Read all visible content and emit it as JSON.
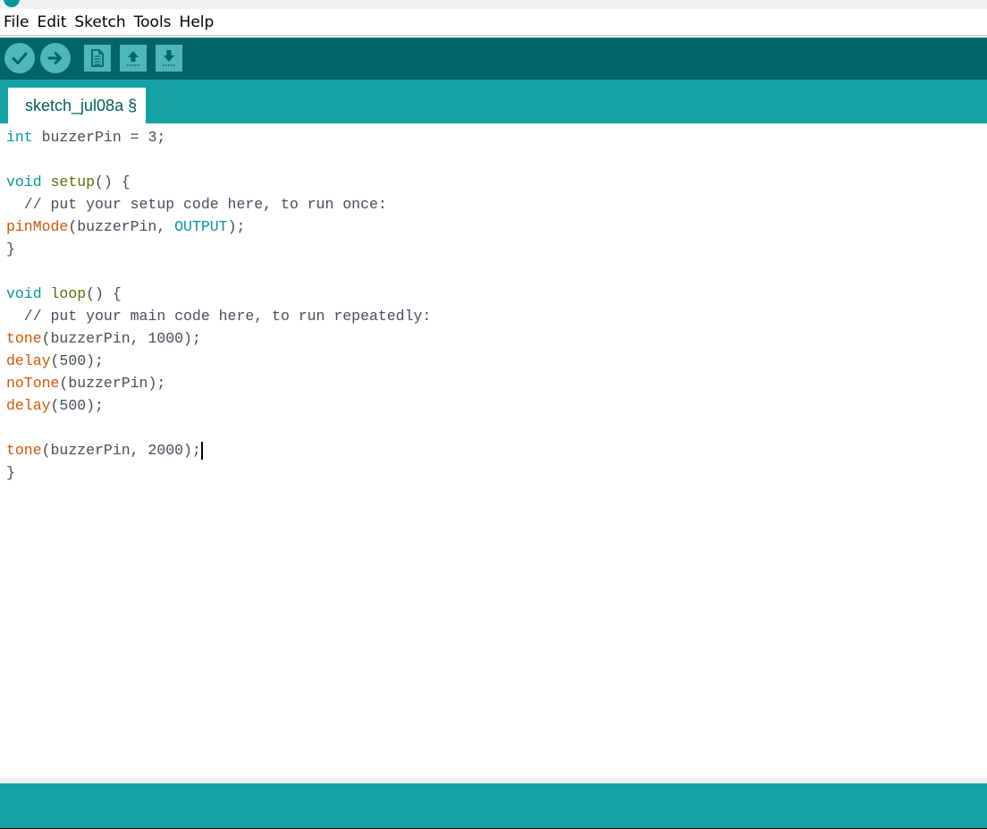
{
  "menu": {
    "items": [
      {
        "label": "File"
      },
      {
        "label": "Edit"
      },
      {
        "label": "Sketch"
      },
      {
        "label": "Tools"
      },
      {
        "label": "Help"
      }
    ]
  },
  "toolbar": {
    "buttons": [
      {
        "name": "verify",
        "icon": "checkmark-icon"
      },
      {
        "name": "upload",
        "icon": "arrow-right-icon"
      },
      {
        "name": "new",
        "icon": "document-icon"
      },
      {
        "name": "open",
        "icon": "arrow-up-icon"
      },
      {
        "name": "save",
        "icon": "arrow-down-icon"
      }
    ]
  },
  "tabs": [
    {
      "label": "sketch_jul08a §",
      "active": true
    }
  ],
  "editor": {
    "lines": [
      {
        "t1": "int",
        "t2": " buzzerPin = 3;"
      },
      {},
      {
        "t1": "void",
        "t2": " ",
        "t3": "setup",
        "t4": "() {"
      },
      {
        "t1": "  // put your setup code here, to run once:"
      },
      {
        "t1": "pinMode",
        "t2": "(buzzerPin, ",
        "t3": "OUTPUT",
        "t4": ");"
      },
      {
        "t1": "}"
      },
      {},
      {
        "t1": "void",
        "t2": " ",
        "t3": "loop",
        "t4": "() {"
      },
      {
        "t1": "  // put your main code here, to run repeatedly:"
      },
      {
        "t1": "tone",
        "t2": "(buzzerPin, 1000);"
      },
      {
        "t1": "delay",
        "t2": "(500);"
      },
      {
        "t1": "noTone",
        "t2": "(buzzerPin);"
      },
      {
        "t1": "delay",
        "t2": "(500);"
      },
      {},
      {
        "t1": "tone",
        "t2": "(buzzerPin, 2000);"
      },
      {
        "t1": "}"
      }
    ]
  },
  "colors": {
    "toolbar_bg": "#006468",
    "tabbar_bg": "#17a1a5",
    "button_bg": "#4db7bb",
    "keyword": "#00979c",
    "function": "#d35400",
    "structure": "#5e6d03",
    "text": "#434f54"
  }
}
